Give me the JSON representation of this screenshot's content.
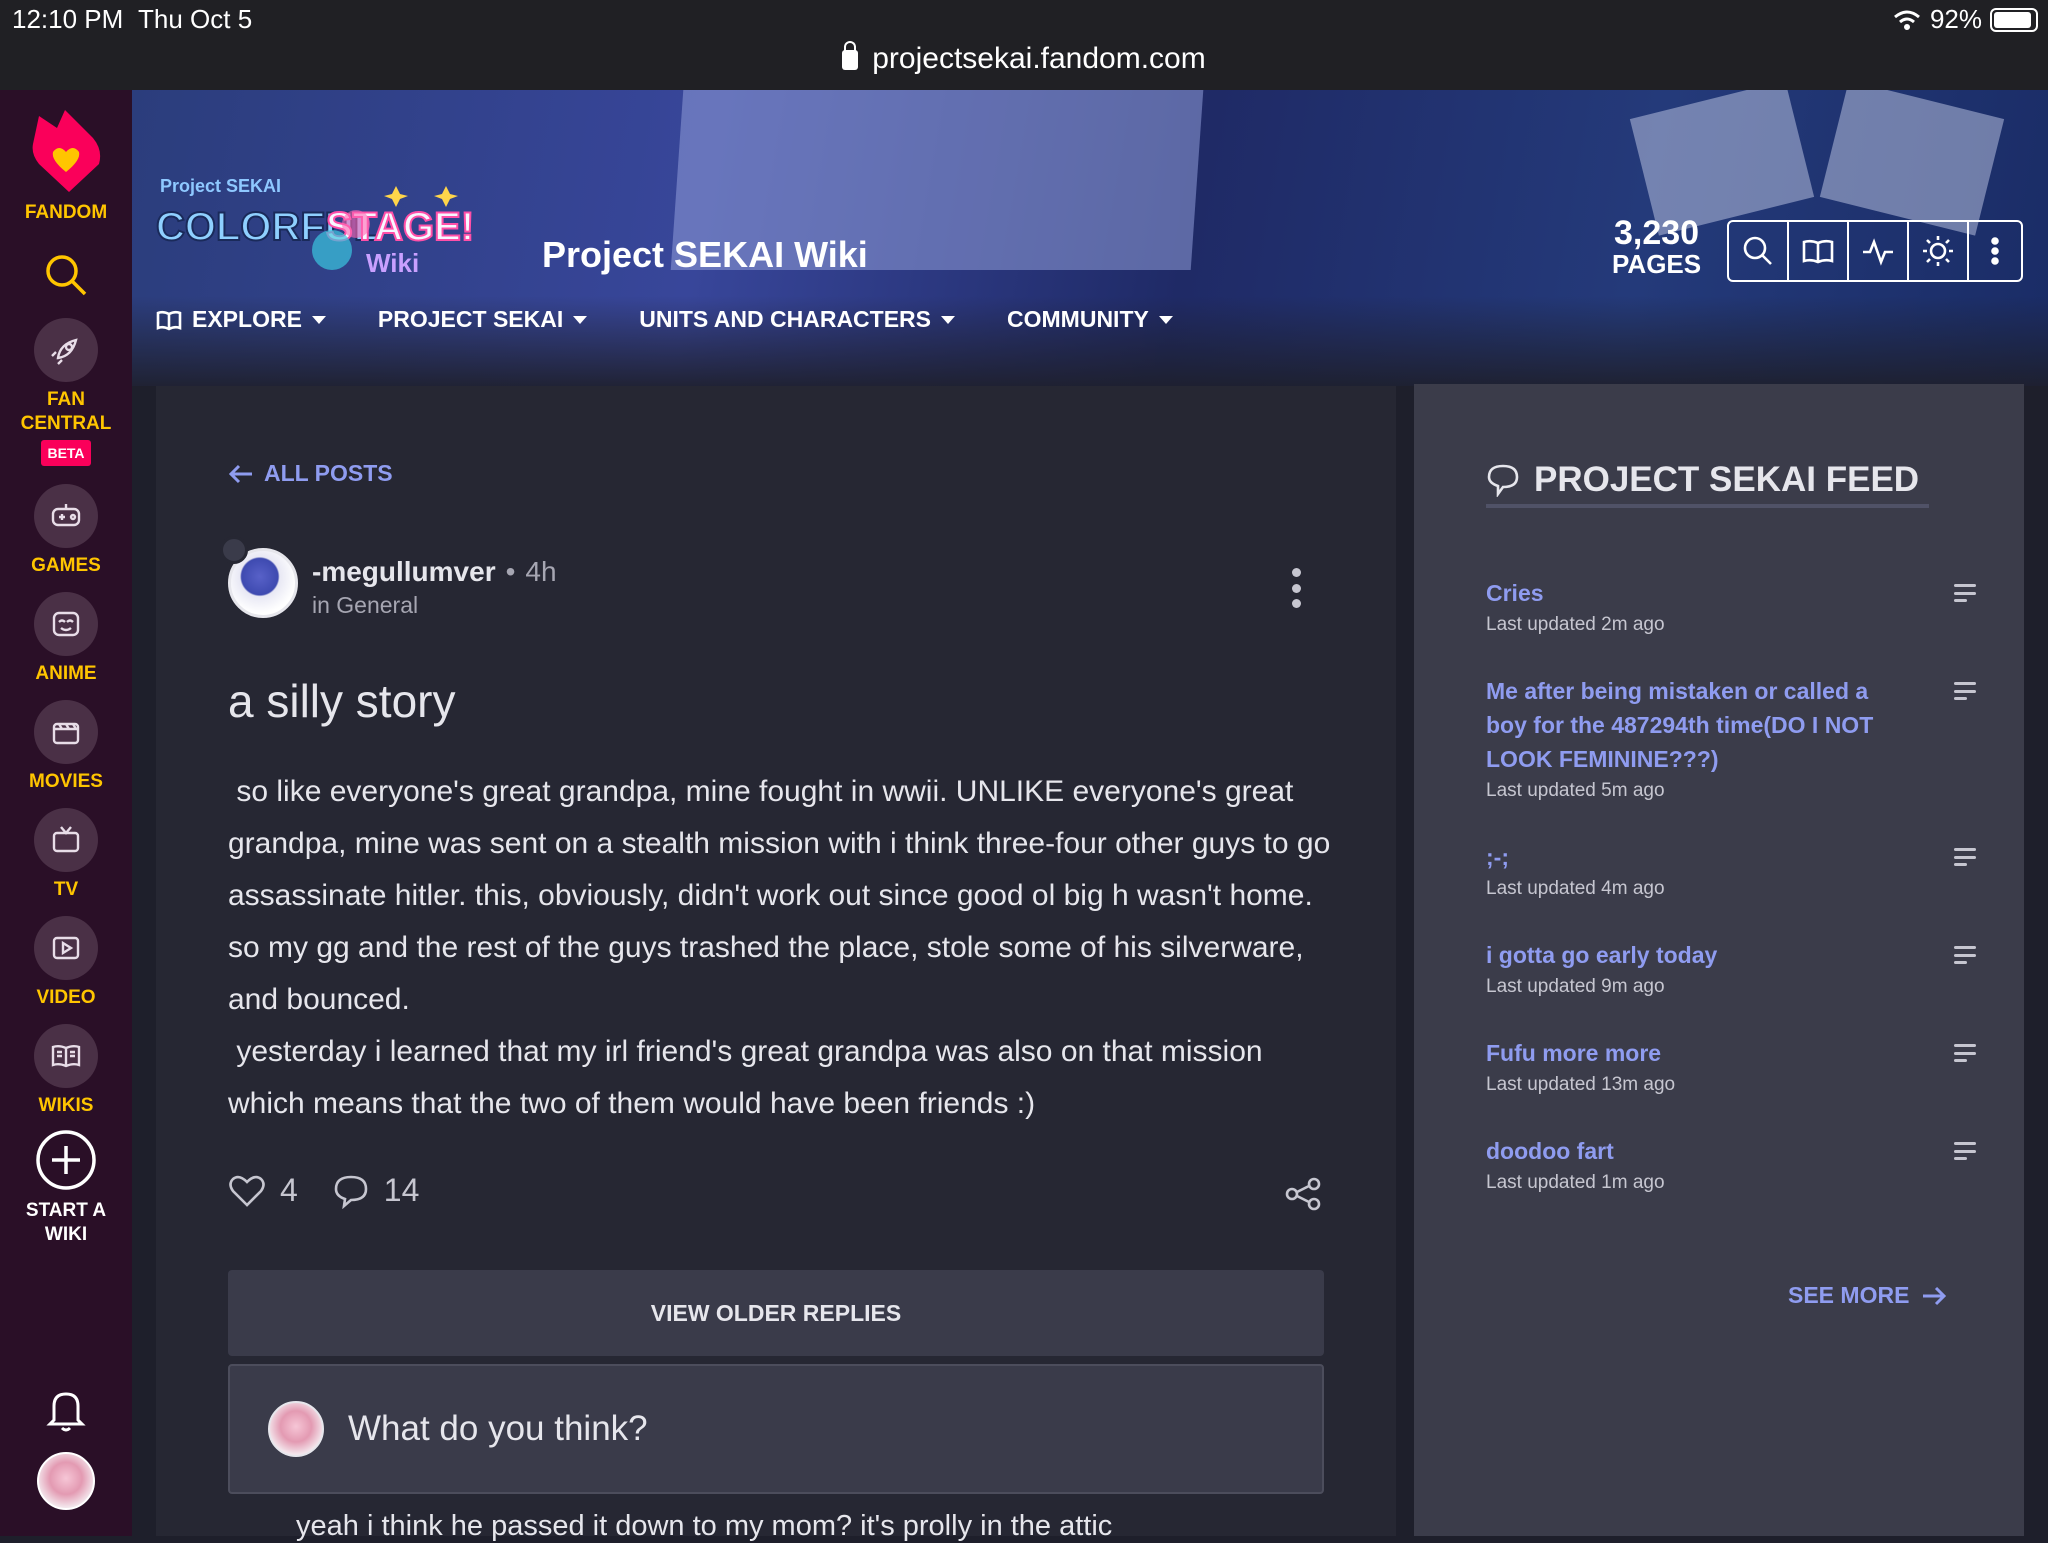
{
  "status_bar": {
    "time": "12:10 PM",
    "date": "Thu Oct 5",
    "battery": "92%",
    "battery_level": 0.92,
    "url": "projectsekai.fandom.com"
  },
  "rail": {
    "brand": "FANDOM",
    "items": [
      {
        "label": "FAN\nCENTRAL",
        "badge": "BETA"
      },
      {
        "label": "GAMES"
      },
      {
        "label": "ANIME"
      },
      {
        "label": "MOVIES"
      },
      {
        "label": "TV"
      },
      {
        "label": "VIDEO"
      },
      {
        "label": "WIKIS"
      }
    ],
    "start_wiki": "START A\nWIKI"
  },
  "header": {
    "logo_text": "Project SEKAI COLORFUL STAGE! Wiki",
    "title": "Project SEKAI Wiki",
    "page_count": "3,230",
    "page_count_label": "PAGES",
    "nav": [
      {
        "label": "EXPLORE"
      },
      {
        "label": "PROJECT SEKAI"
      },
      {
        "label": "UNITS AND CHARACTERS"
      },
      {
        "label": "COMMUNITY"
      }
    ]
  },
  "post": {
    "back_label": "ALL POSTS",
    "author": "-megullumver",
    "separator": "•",
    "time": "4h",
    "category": "in General",
    "title": "a silly story",
    "body": " so like everyone's great grandpa, mine fought in wwii. UNLIKE everyone's great grandpa, mine was sent on a stealth mission with i think three-four other guys to go assassinate hitler. this, obviously, didn't work out since good ol big h wasn't home. so my gg and the rest of the guys trashed the place, stole some of his silverware, and bounced.\n yesterday i learned that my irl friend's great grandpa was also on that mission which means that the two of them would have been friends :)",
    "likes": "4",
    "comments": "14",
    "older_replies": "VIEW OLDER REPLIES",
    "reply_placeholder": "What do you think?",
    "reply_preview": "yeah i think he passed it down to my mom? it's prolly in the attic"
  },
  "feed": {
    "title": "PROJECT SEKAI FEED",
    "items": [
      {
        "title": "Cries",
        "meta": "Last updated 2m ago"
      },
      {
        "title": "Me after being mistaken or called a boy for the 487294th time(DO I NOT LOOK FEMININE???)",
        "meta": "Last updated 5m ago"
      },
      {
        "title": ";-;",
        "meta": "Last updated 4m ago"
      },
      {
        "title": "i gotta go early today",
        "meta": "Last updated 9m ago"
      },
      {
        "title": "Fufu more more",
        "meta": "Last updated 13m ago"
      },
      {
        "title": "doodoo fart",
        "meta": "Last updated 1m ago"
      }
    ],
    "see_more": "SEE MORE"
  }
}
